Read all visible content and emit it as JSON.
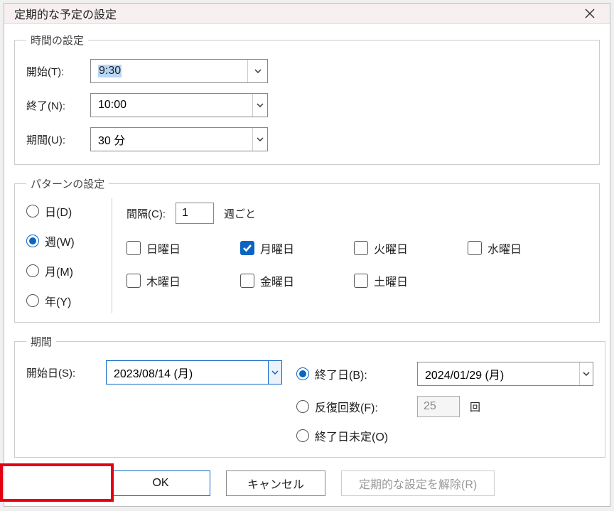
{
  "dialog": {
    "title": "定期的な予定の設定"
  },
  "time": {
    "legend": "時間の設定",
    "start_label": "開始(T):",
    "start_value": "9:30",
    "end_label": "終了(N):",
    "end_value": "10:00",
    "span_label": "期間(U):",
    "span_value": "30 分"
  },
  "pattern": {
    "legend": "パターンの設定",
    "units": {
      "day": "日(D)",
      "week": "週(W)",
      "month": "月(M)",
      "year": "年(Y)",
      "selected": "week"
    },
    "interval_label": "間隔(C):",
    "interval_value": "1",
    "interval_suffix": "週ごと",
    "days": [
      {
        "key": "sun",
        "label": "日曜日",
        "checked": false
      },
      {
        "key": "mon",
        "label": "月曜日",
        "checked": true
      },
      {
        "key": "tue",
        "label": "火曜日",
        "checked": false
      },
      {
        "key": "wed",
        "label": "水曜日",
        "checked": false
      },
      {
        "key": "thu",
        "label": "木曜日",
        "checked": false
      },
      {
        "key": "fri",
        "label": "金曜日",
        "checked": false
      },
      {
        "key": "sat",
        "label": "土曜日",
        "checked": false
      }
    ]
  },
  "range": {
    "legend": "期間",
    "start_label": "開始日(S):",
    "start_value": "2023/08/14 (月)",
    "end_by_label": "終了日(B):",
    "end_by_value": "2024/01/29 (月)",
    "end_after_label": "反復回数(F):",
    "end_after_value": "25",
    "end_after_suffix": "回",
    "no_end_label": "終了日未定(O)",
    "selected": "end_by"
  },
  "buttons": {
    "ok": "OK",
    "cancel": "キャンセル",
    "remove": "定期的な設定を解除(R)"
  }
}
